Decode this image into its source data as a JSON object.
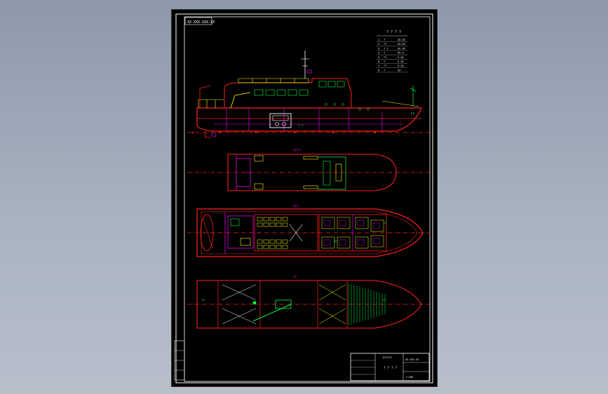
{
  "drawing": {
    "title_tag": "XX-XXX-XXX-XX",
    "param_table": {
      "heading": "? ? ? ?",
      "rows": [
        [
          "1",
          "?",
          "XX.XX"
        ],
        [
          "2",
          "??",
          "XX.XX"
        ],
        [
          "3",
          "? ?",
          "XX.XX"
        ],
        [
          "4",
          "?",
          "XX.X"
        ],
        [
          "5",
          "??",
          "X.XX"
        ],
        [
          "6",
          "?",
          "X.XX"
        ],
        [
          "7",
          "??",
          "X.XX"
        ],
        [
          "8",
          "?",
          "XX"
        ]
      ]
    },
    "views": {
      "upper_deck_label": "????",
      "main_deck_label": "???",
      "hold_label": "??"
    },
    "title_block": {
      "project": "?????",
      "drawing_name": "? ? ? ?",
      "drawing_no": "XX-XXX-XX",
      "scale_note": "1:100"
    }
  },
  "colors": {
    "background": "#000000",
    "hull": "#ff2020",
    "structure": "#ff00ff",
    "equipment": "#ffff00",
    "green": "#00ff40",
    "white": "#ffffff",
    "cyan": "#00e5ff",
    "frame": "#ffffff"
  }
}
